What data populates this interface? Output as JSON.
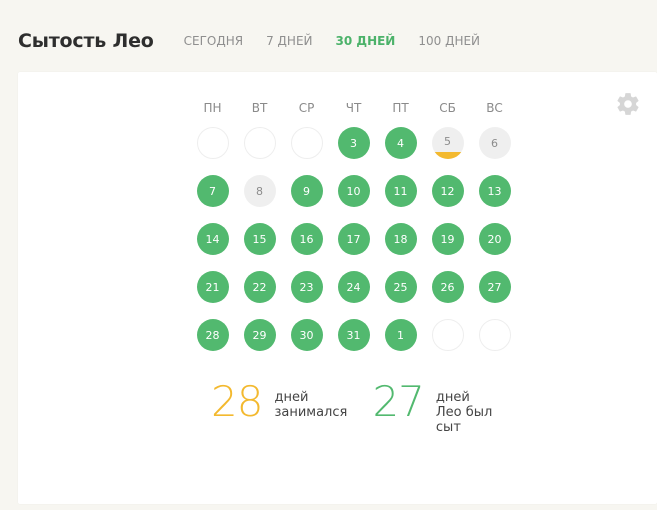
{
  "header": {
    "title": "Сытость Лео",
    "tabs": [
      {
        "label": "СЕГОДНЯ",
        "active": false
      },
      {
        "label": "7 ДНЕЙ",
        "active": false
      },
      {
        "label": "30 ДНЕЙ",
        "active": true
      },
      {
        "label": "100 ДНЕЙ",
        "active": false
      }
    ]
  },
  "calendar": {
    "weekdays": [
      "ПН",
      "ВТ",
      "СР",
      "ЧТ",
      "ПТ",
      "СБ",
      "ВС"
    ],
    "days": [
      {
        "label": "",
        "state": "empty"
      },
      {
        "label": "",
        "state": "empty"
      },
      {
        "label": "",
        "state": "empty"
      },
      {
        "label": "3",
        "state": "green"
      },
      {
        "label": "4",
        "state": "green"
      },
      {
        "label": "5",
        "state": "partial"
      },
      {
        "label": "6",
        "state": "gray"
      },
      {
        "label": "7",
        "state": "green"
      },
      {
        "label": "8",
        "state": "gray"
      },
      {
        "label": "9",
        "state": "green"
      },
      {
        "label": "10",
        "state": "green"
      },
      {
        "label": "11",
        "state": "green"
      },
      {
        "label": "12",
        "state": "green"
      },
      {
        "label": "13",
        "state": "green"
      },
      {
        "label": "14",
        "state": "green"
      },
      {
        "label": "15",
        "state": "green"
      },
      {
        "label": "16",
        "state": "green"
      },
      {
        "label": "17",
        "state": "green"
      },
      {
        "label": "18",
        "state": "green"
      },
      {
        "label": "19",
        "state": "green"
      },
      {
        "label": "20",
        "state": "green"
      },
      {
        "label": "21",
        "state": "green"
      },
      {
        "label": "22",
        "state": "green"
      },
      {
        "label": "23",
        "state": "green"
      },
      {
        "label": "24",
        "state": "green"
      },
      {
        "label": "25",
        "state": "green"
      },
      {
        "label": "26",
        "state": "green"
      },
      {
        "label": "27",
        "state": "green"
      },
      {
        "label": "28",
        "state": "green"
      },
      {
        "label": "29",
        "state": "green"
      },
      {
        "label": "30",
        "state": "green"
      },
      {
        "label": "31",
        "state": "green"
      },
      {
        "label": "1",
        "state": "green"
      },
      {
        "label": "",
        "state": "empty"
      },
      {
        "label": "",
        "state": "empty"
      }
    ]
  },
  "stats": {
    "practiced": {
      "value": "28",
      "label_lines": [
        "дней",
        "занимался"
      ]
    },
    "fed": {
      "value": "27",
      "label_lines": [
        "дней",
        "Лео был",
        "сыт"
      ]
    }
  },
  "colors": {
    "green": "#52b96f",
    "yellow": "#f3b92f",
    "gray": "#efefef"
  },
  "icons": {
    "settings": "gear-icon"
  }
}
